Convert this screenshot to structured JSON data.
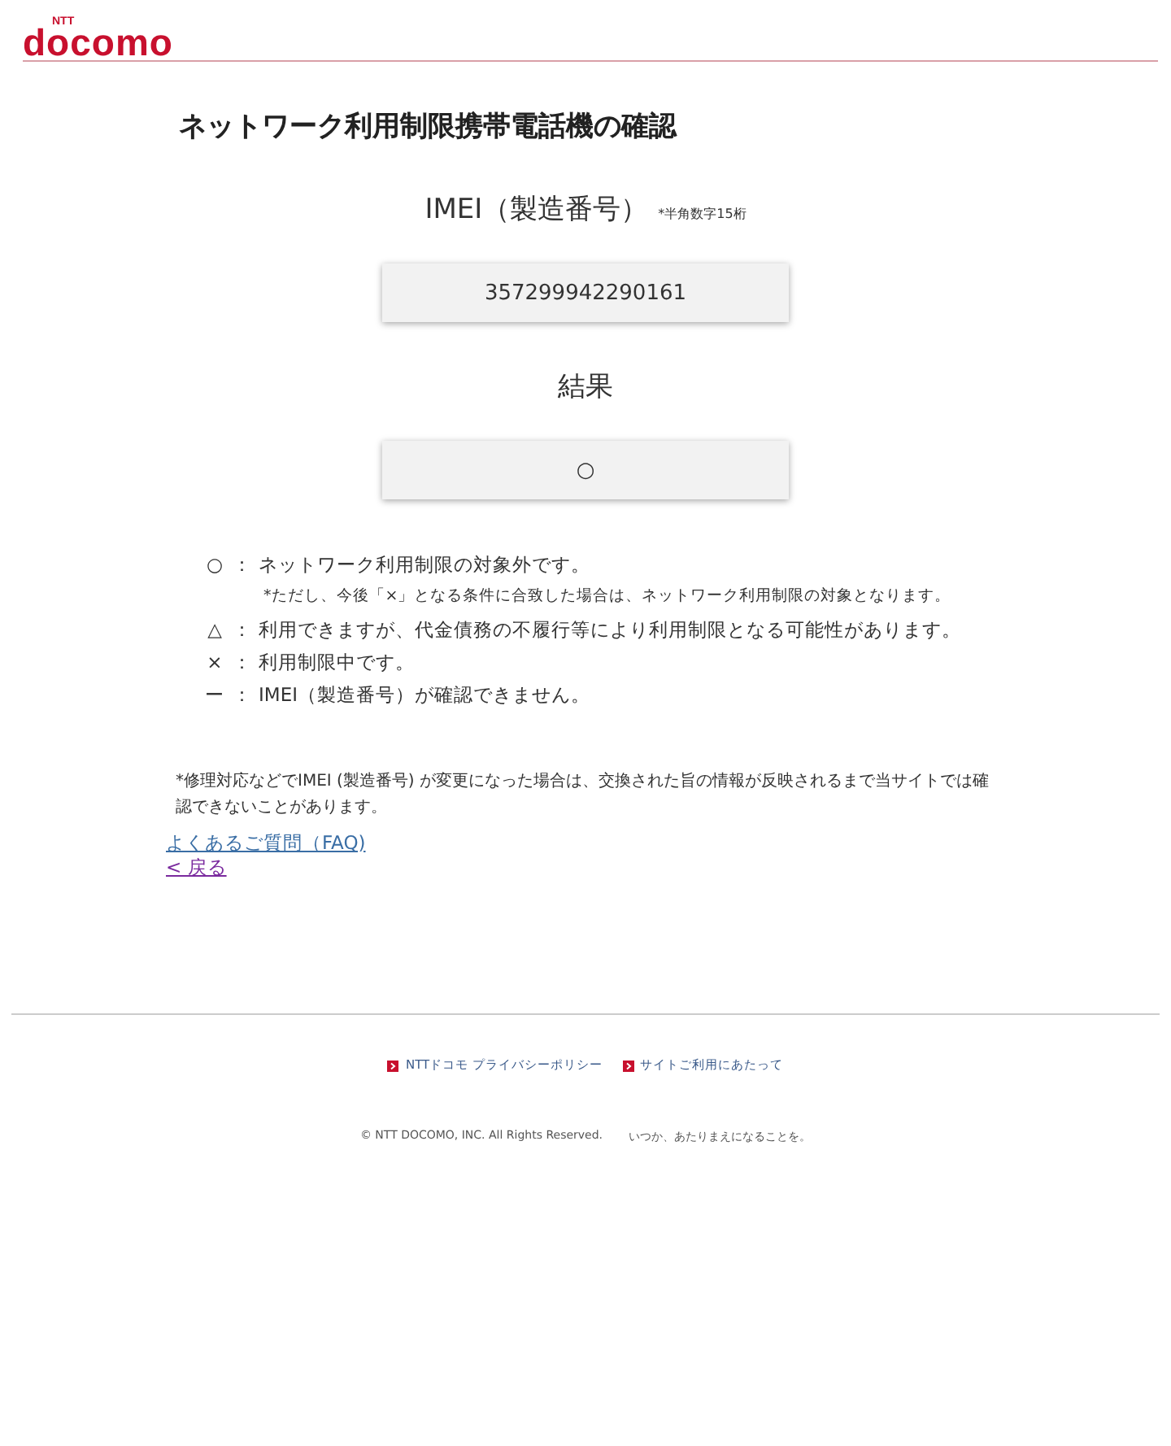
{
  "header": {
    "logo_small": "NTT",
    "logo": "docomo"
  },
  "title": "ネットワーク利用制限携帯電話機の確認",
  "imei": {
    "label": "IMEI（製造番号）",
    "note": "*半角数字15桁",
    "value": "357299942290161"
  },
  "result": {
    "label": "結果",
    "value": "○"
  },
  "legend": [
    {
      "symbol": "○",
      "separator": "：",
      "text": "ネットワーク利用制限の対象外です。",
      "note": "*ただし、今後「×」となる条件に合致した場合は、ネットワーク利用制限の対象となります。"
    },
    {
      "symbol": "△",
      "separator": "：",
      "text": "利用できますが、代金債務の不履行等により利用制限となる可能性があります。"
    },
    {
      "symbol": "×",
      "separator": "：",
      "text": "利用制限中です。"
    },
    {
      "symbol": "ー",
      "separator": "：",
      "text": "IMEI（製造番号）が確認できません。"
    }
  ],
  "notice": "*修理対応などでIMEI (製造番号) が変更になった場合は、交換された旨の情報が反映されるまで当サイトでは確認できないことがあります。",
  "links": [
    {
      "text": "よくあるご質問（FAQ)",
      "visited": false
    },
    {
      "text": "< 戻る",
      "visited": true
    }
  ],
  "footer": {
    "links": [
      "NTTドコモ プライバシーポリシー",
      "サイトご利用にあたって"
    ],
    "copyright": "© NTT DOCOMO, INC. All Rights Reserved.",
    "tagline": "いつか、あたりまえになることを。"
  }
}
